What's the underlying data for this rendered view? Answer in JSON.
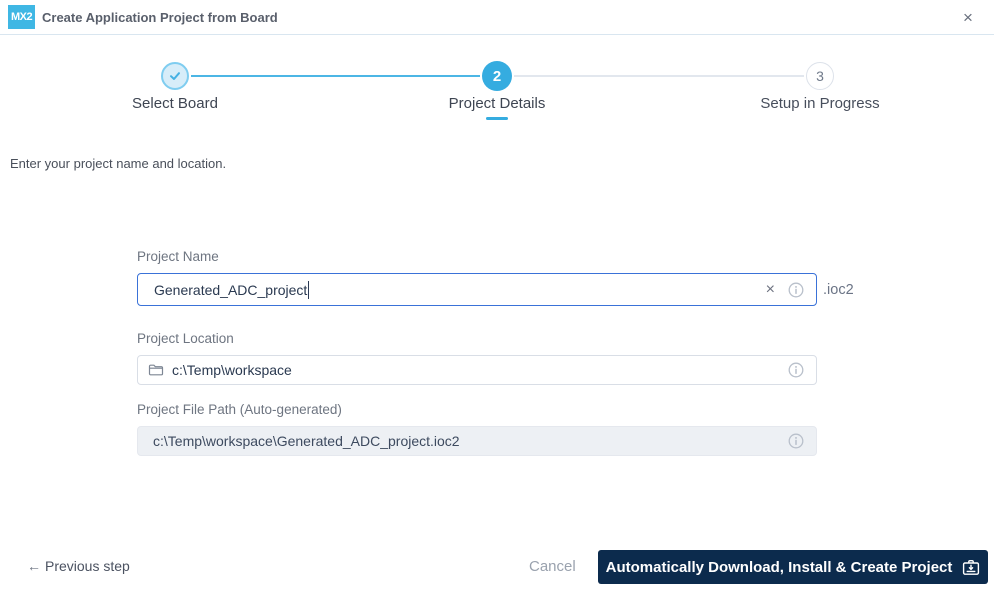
{
  "window": {
    "logo_text": "MX2",
    "title": "Create Application Project from Board",
    "close_glyph": "×"
  },
  "stepper": {
    "steps": [
      {
        "label": "Select Board",
        "state": "done"
      },
      {
        "label": "Project Details",
        "number": "2",
        "state": "active"
      },
      {
        "label": "Setup in Progress",
        "number": "3",
        "state": "upcoming"
      }
    ]
  },
  "instruction": "Enter your project name and location.",
  "form": {
    "project_name": {
      "label": "Project Name",
      "value": "Generated_ADC_project",
      "suffix": ".ioc2",
      "clear_glyph": "×"
    },
    "project_location": {
      "label": "Project Location",
      "value": "c:\\Temp\\workspace"
    },
    "project_file_path": {
      "label": "Project File Path (Auto-generated)",
      "value": "c:\\Temp\\workspace\\Generated_ADC_project.ioc2"
    }
  },
  "footer": {
    "previous_arrow": "←",
    "previous_label": "Previous step",
    "cancel_label": "Cancel",
    "primary_label": "Automatically Download, Install & Create Project"
  },
  "colors": {
    "accent_blue": "#35ace0",
    "focus_border": "#3a72d8",
    "primary_button_bg": "#0c2b4d",
    "logo_bg": "#3fb7e4",
    "disabled_input_bg": "#edf0f4"
  }
}
